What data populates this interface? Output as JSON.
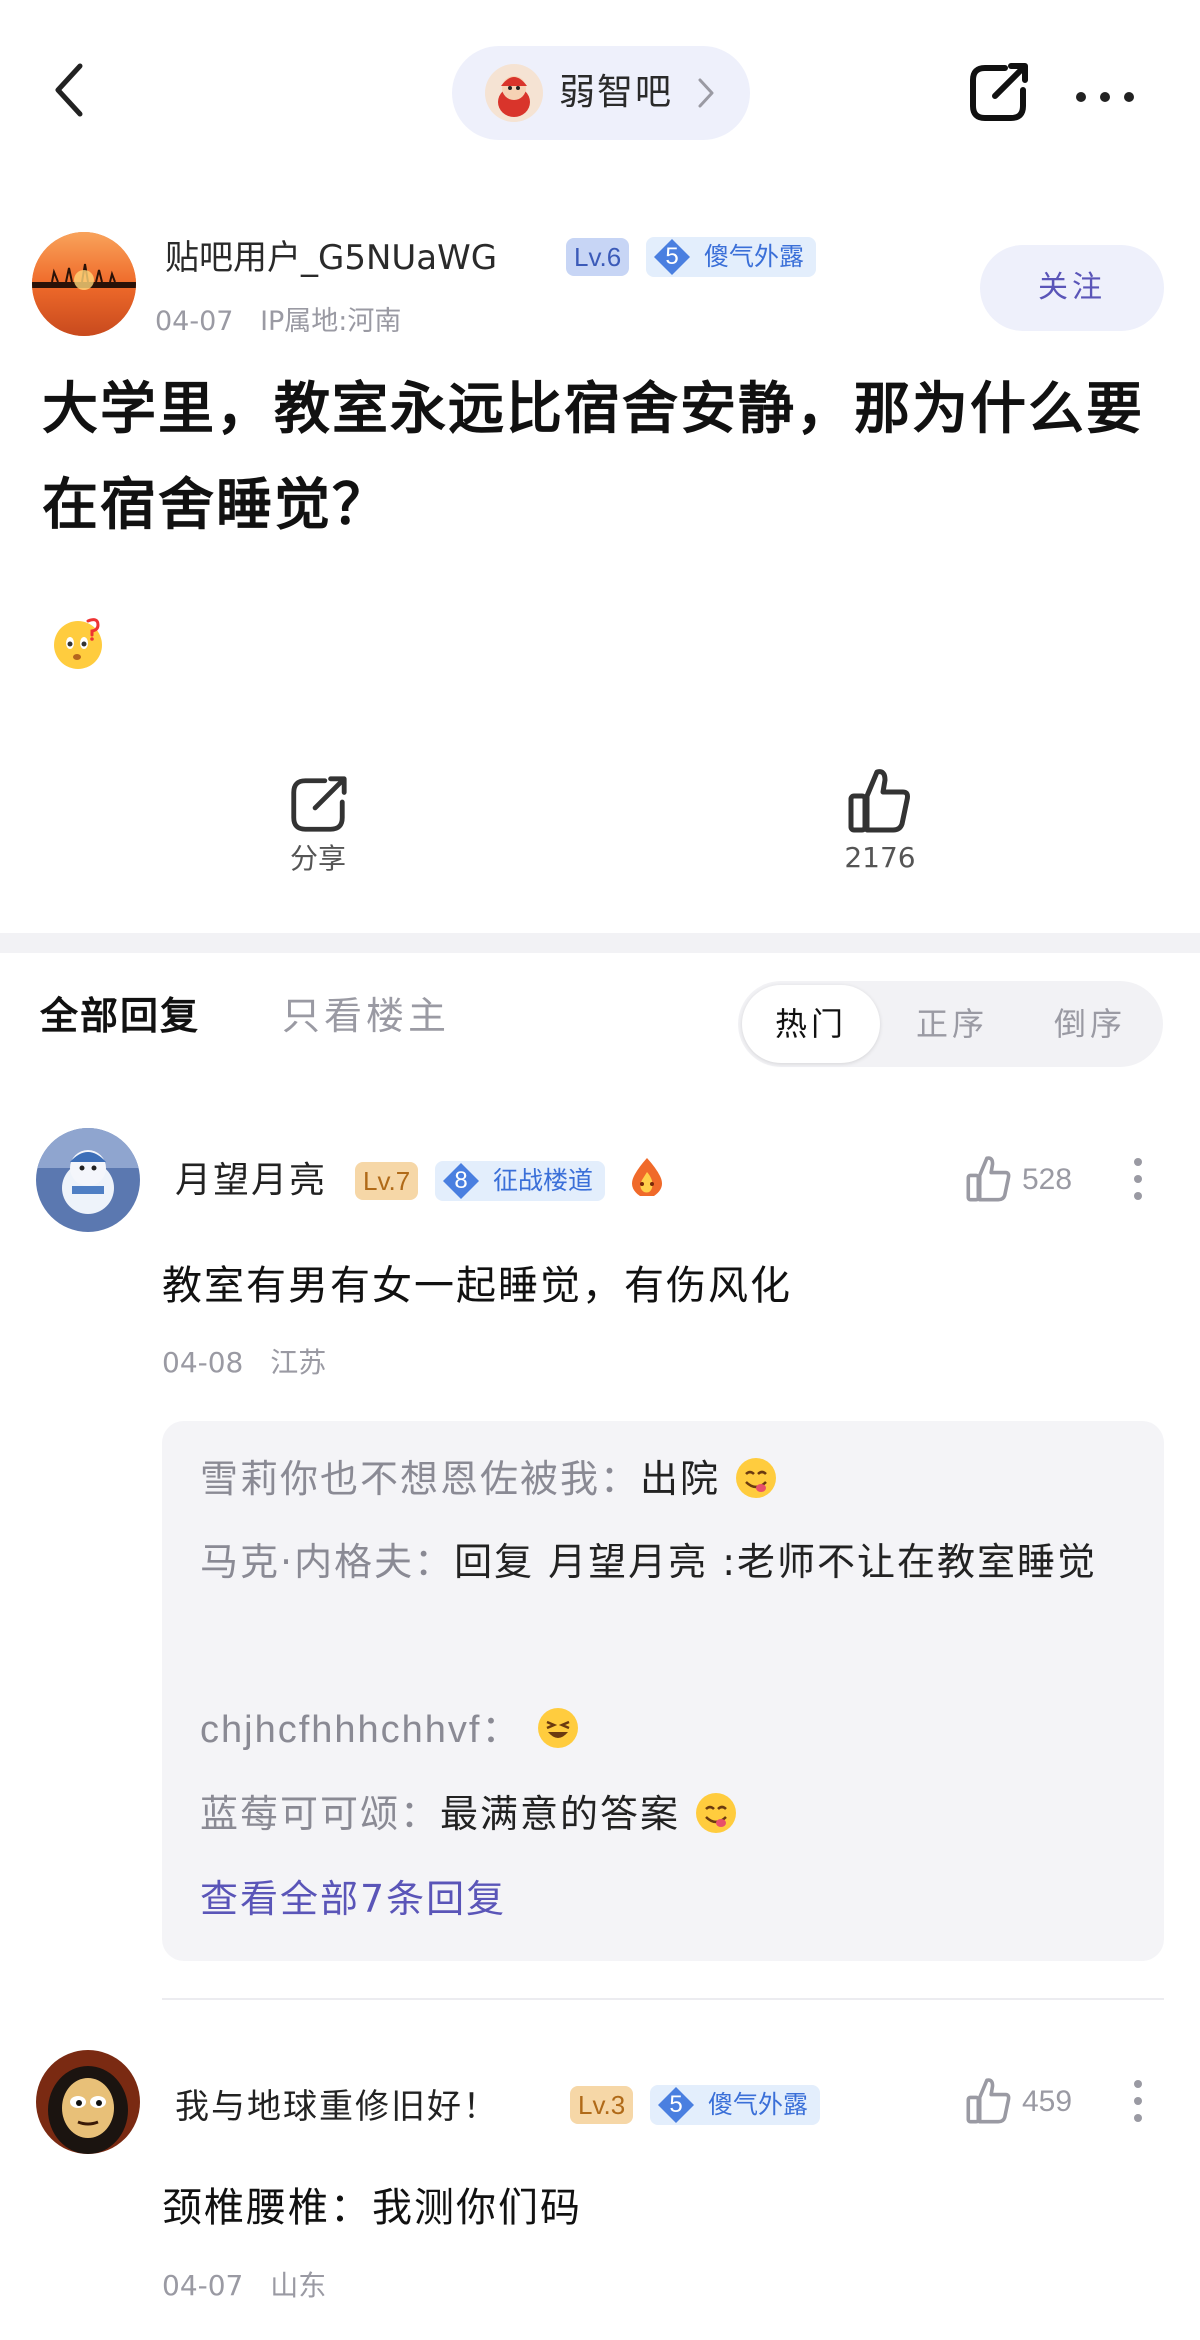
{
  "header": {
    "forum_name": "弱智吧"
  },
  "post": {
    "author": {
      "name": "贴吧用户_G5NUaWG",
      "level": "Lv.6",
      "honor_level": "5",
      "honor_title": "傻气外露",
      "date": "04-07",
      "ip": "IP属地:河南"
    },
    "follow_label": "关注",
    "title": "大学里，教室永远比宿舍安静，那为什么要在宿舍睡觉？",
    "share_label": "分享",
    "like_count": "2176"
  },
  "tabs": {
    "all": "全部回复",
    "owner_only": "只看楼主",
    "sort": [
      "热门",
      "正序",
      "倒序"
    ]
  },
  "comments": [
    {
      "name": "月望月亮",
      "level": "Lv.7",
      "honor_level": "8",
      "honor_title": "征战楼道",
      "likes": "528",
      "body": "教室有男有女一起睡觉，有伤风化",
      "date": "04-08",
      "location": "江苏",
      "replies": [
        {
          "author": "雪莉你也不想恩佐被我：",
          "text": "出院"
        },
        {
          "author": "马克·内格夫：",
          "text": "回复 月望月亮 :老师不让在教室睡觉"
        },
        {
          "author": "chjhcfhhhchhvf：",
          "text": ""
        },
        {
          "author": "蓝莓可可颂：",
          "text": "最满意的答案"
        }
      ],
      "view_all": "查看全部7条回复"
    },
    {
      "name": "我与地球重修旧好！",
      "level": "Lv.3",
      "honor_level": "5",
      "honor_title": "傻气外露",
      "likes": "459",
      "body": "颈椎腰椎：我测你们码",
      "date": "04-07",
      "location": "山东"
    }
  ]
}
